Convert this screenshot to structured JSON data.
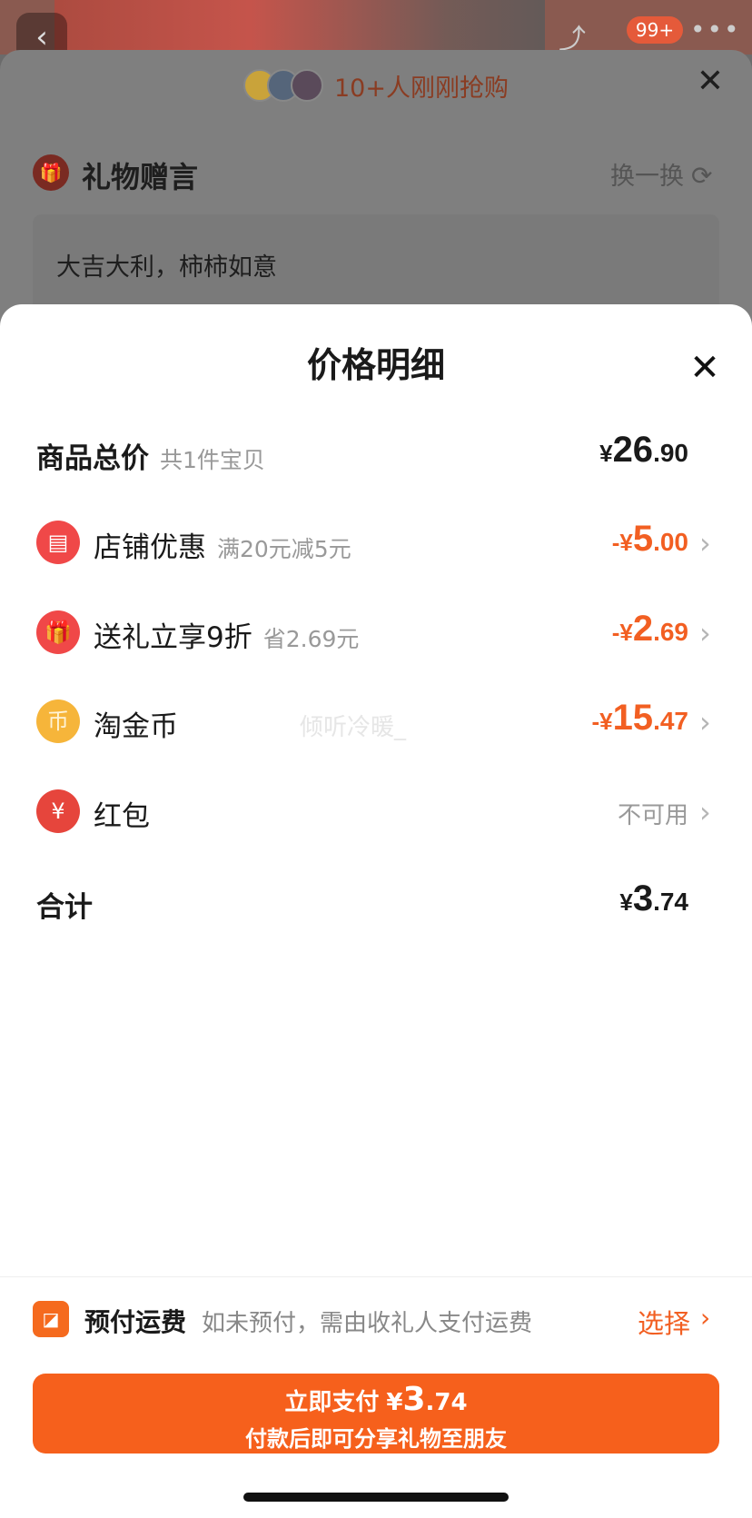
{
  "app_header": {
    "badge": "99+"
  },
  "background_sheet": {
    "buyers_text": "10+人刚刚抢购",
    "gift_message_title": "礼物赠言",
    "swap_label": "换一换",
    "message_text": "大吉大利，柿柿如意"
  },
  "price_sheet": {
    "title": "价格明细",
    "goods_total": {
      "label": "商品总价",
      "sub": "共1件宝贝",
      "currency": "¥",
      "int": "26",
      "dec": ".90"
    },
    "items": [
      {
        "label": "店铺优惠",
        "sub": "满20元减5元",
        "sign": "-¥",
        "int": "5",
        "dec": ".00",
        "icon": "shop-icon"
      },
      {
        "label": "送礼立享9折",
        "sub": "省2.69元",
        "sign": "-¥",
        "int": "2",
        "dec": ".69",
        "icon": "gift-icon"
      },
      {
        "label": "淘金币",
        "sub": "",
        "sign": "-¥",
        "int": "15",
        "dec": ".47",
        "icon": "coin-icon"
      },
      {
        "label": "红包",
        "sub": "",
        "status": "不可用",
        "icon": "red-packet-icon"
      }
    ],
    "watermark": "倾听冷暖_",
    "total": {
      "label": "合计",
      "currency": "¥",
      "int": "3",
      "dec": ".74"
    }
  },
  "freight": {
    "title": "预付运费",
    "desc": "如未预付，需由收礼人支付运费",
    "action": "选择"
  },
  "pay_button": {
    "label": "立即支付",
    "currency": "¥",
    "int": "3",
    "dec": ".74",
    "note": "付款后即可分享礼物至朋友"
  },
  "colors": {
    "accent": "#f6601c",
    "discount": "#f25f22",
    "muted": "#999999"
  }
}
